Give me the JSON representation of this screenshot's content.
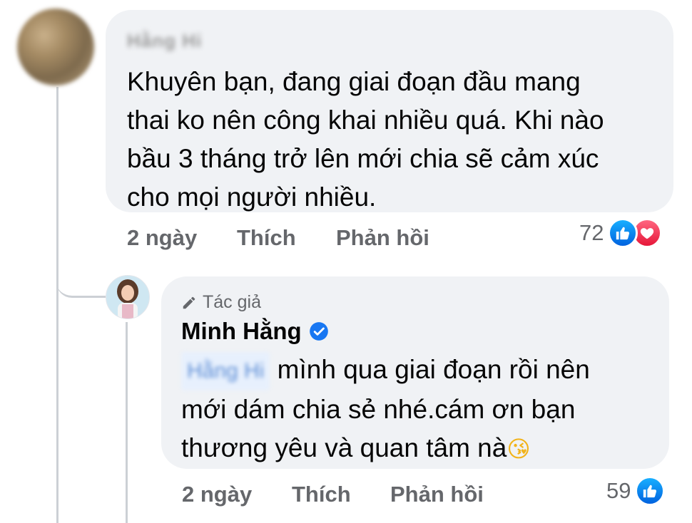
{
  "comment1": {
    "author": "Hằng Hi",
    "text": "Khuyên bạn, đang giai đoạn đầu mang thai ko nên công khai nhiều quá. Khi nào bầu 3 tháng trở lên mới chia sẽ cảm xúc cho mọi người nhiều.",
    "lines": [
      "Khuyên bạn, đang giai đoạn đầu mang",
      "thai ko nên công khai nhiều quá. Khi nào",
      "bầu 3 tháng trở lên mới chia sẽ cảm xúc",
      "cho mọi người nhiều."
    ],
    "time": "2 ngày",
    "like_label": "Thích",
    "reply_label": "Phản hồi",
    "reaction_count": "72",
    "reactions": [
      "like-icon",
      "love-icon"
    ]
  },
  "reply1": {
    "badge": "Tác giả",
    "author": "Minh Hằng",
    "verified": true,
    "mention": "Hằng Hi",
    "lines": [
      "mình qua giai đoạn rồi nên",
      "mới dám chia sẻ nhé.cám ơn bạn",
      "thương yêu và quan tâm nà"
    ],
    "emoji": "😘",
    "time": "2 ngày",
    "like_label": "Thích",
    "reply_label": "Phản hồi",
    "reaction_count": "59",
    "reactions": [
      "like-icon"
    ]
  },
  "colors": {
    "bubble": "#f0f2f5",
    "meta": "#65676b",
    "like": "#1877f2",
    "love": "#f33e58"
  }
}
